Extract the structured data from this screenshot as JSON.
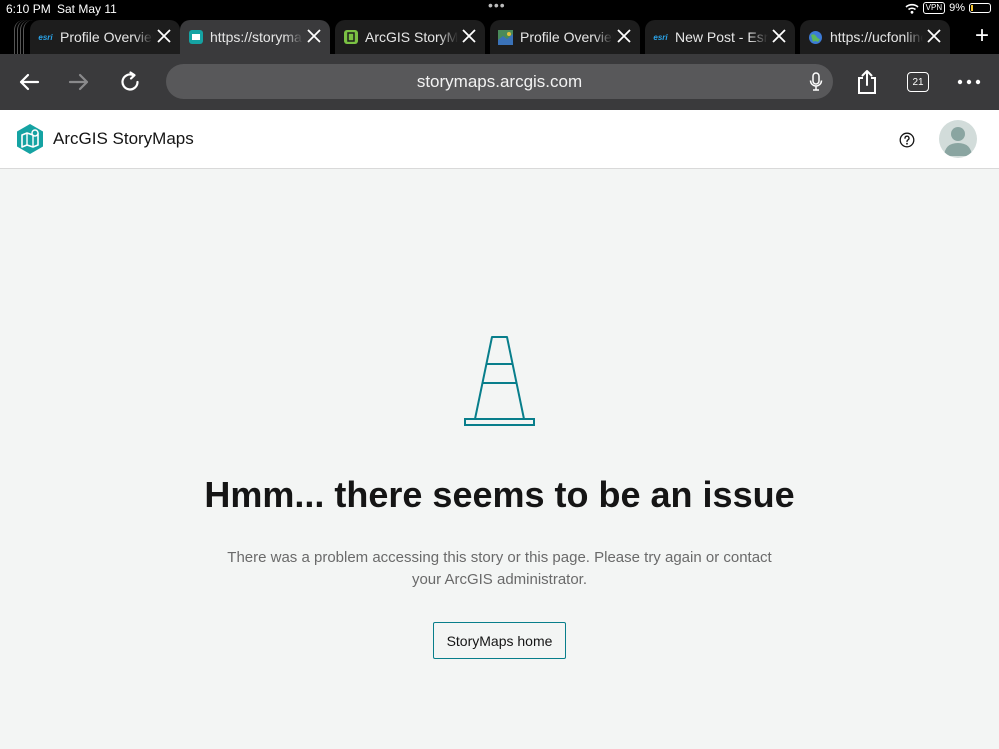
{
  "status_bar": {
    "time": "6:10 PM",
    "date": "Sat May 11",
    "vpn": "VPN",
    "battery": "9%"
  },
  "tabs": [
    {
      "favicon": "esri",
      "title": "Profile Overview",
      "active": false
    },
    {
      "favicon": "storymaps",
      "title": "https://storymaps.arcgis.com",
      "active": true
    },
    {
      "favicon": "arcgis-storymaps",
      "title": "ArcGIS StoryMaps",
      "active": false
    },
    {
      "favicon": "map-thumbnail",
      "title": "Profile Overview",
      "active": false
    },
    {
      "favicon": "esri",
      "title": "New Post - Esri Community",
      "active": false
    },
    {
      "favicon": "globe",
      "title": "https://ucfonline.ucf.edu",
      "active": false
    }
  ],
  "toolbar": {
    "url": "storymaps.arcgis.com",
    "tab_count": "21"
  },
  "site": {
    "brand": "ArcGIS StoryMaps"
  },
  "error": {
    "heading": "Hmm... there seems to be an issue",
    "message": "There was a problem accessing this story or this page. Please try again or contact your ArcGIS administrator.",
    "button": "StoryMaps home"
  },
  "colors": {
    "accent": "#087e8b",
    "toolbar": "#3a3a3c",
    "page_bg": "#f3f5f4"
  }
}
